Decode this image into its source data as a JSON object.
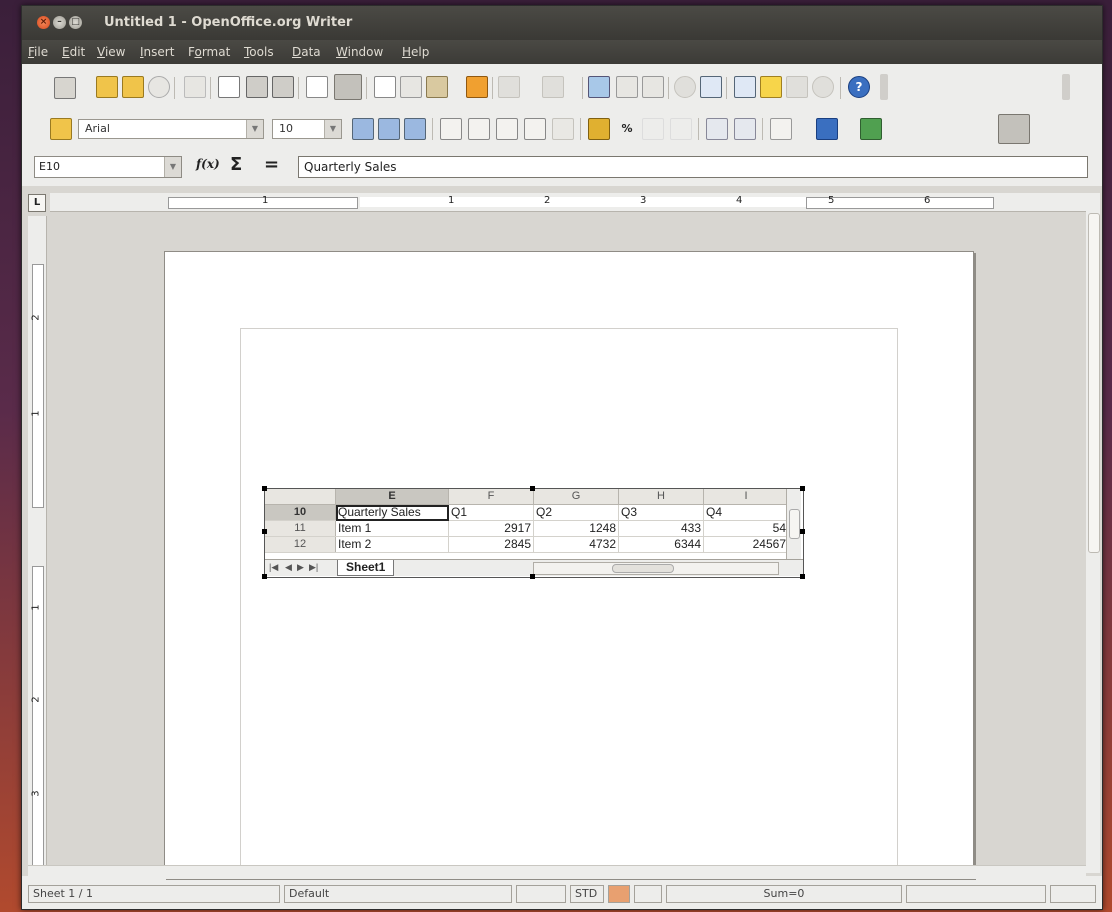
{
  "window": {
    "title": "Untitled 1 - OpenOffice.org Writer"
  },
  "menu": [
    "File",
    "Edit",
    "View",
    "Insert",
    "Format",
    "Tools",
    "Data",
    "Window",
    "Help"
  ],
  "menu_accel": [
    "F",
    "E",
    "V",
    "I",
    "o",
    "T",
    "D",
    "W",
    "H"
  ],
  "formatting": {
    "font_name": "Arial",
    "font_size": "10"
  },
  "formula_bar": {
    "cell_ref": "E10",
    "fx": "f(x)",
    "sigma": "Σ",
    "equals": "=",
    "content": "Quarterly Sales"
  },
  "ruler": {
    "marks": [
      "1",
      "1",
      "2",
      "3",
      "4",
      "5",
      "6"
    ],
    "vmarks": [
      "2",
      "1",
      "1",
      "2",
      "3"
    ]
  },
  "spreadsheet": {
    "columns": [
      "E",
      "F",
      "G",
      "H",
      "I"
    ],
    "rows": [
      {
        "num": "10",
        "cells": [
          "Quarterly Sales",
          "Q1",
          "Q2",
          "Q3",
          "Q4"
        ]
      },
      {
        "num": "11",
        "cells": [
          "Item 1",
          "2917",
          "1248",
          "433",
          "54"
        ]
      },
      {
        "num": "12",
        "cells": [
          "Item 2",
          "2845",
          "4732",
          "6344",
          "24567"
        ]
      }
    ],
    "sheet_tab": "Sheet1"
  },
  "status": {
    "page": "Sheet 1 / 1",
    "style": "Default",
    "mode": "STD",
    "sum": "Sum=0"
  },
  "colors": {
    "titlebar": "#3c3b37",
    "close": "#e2562a",
    "desktop": "#5a2b4a"
  }
}
